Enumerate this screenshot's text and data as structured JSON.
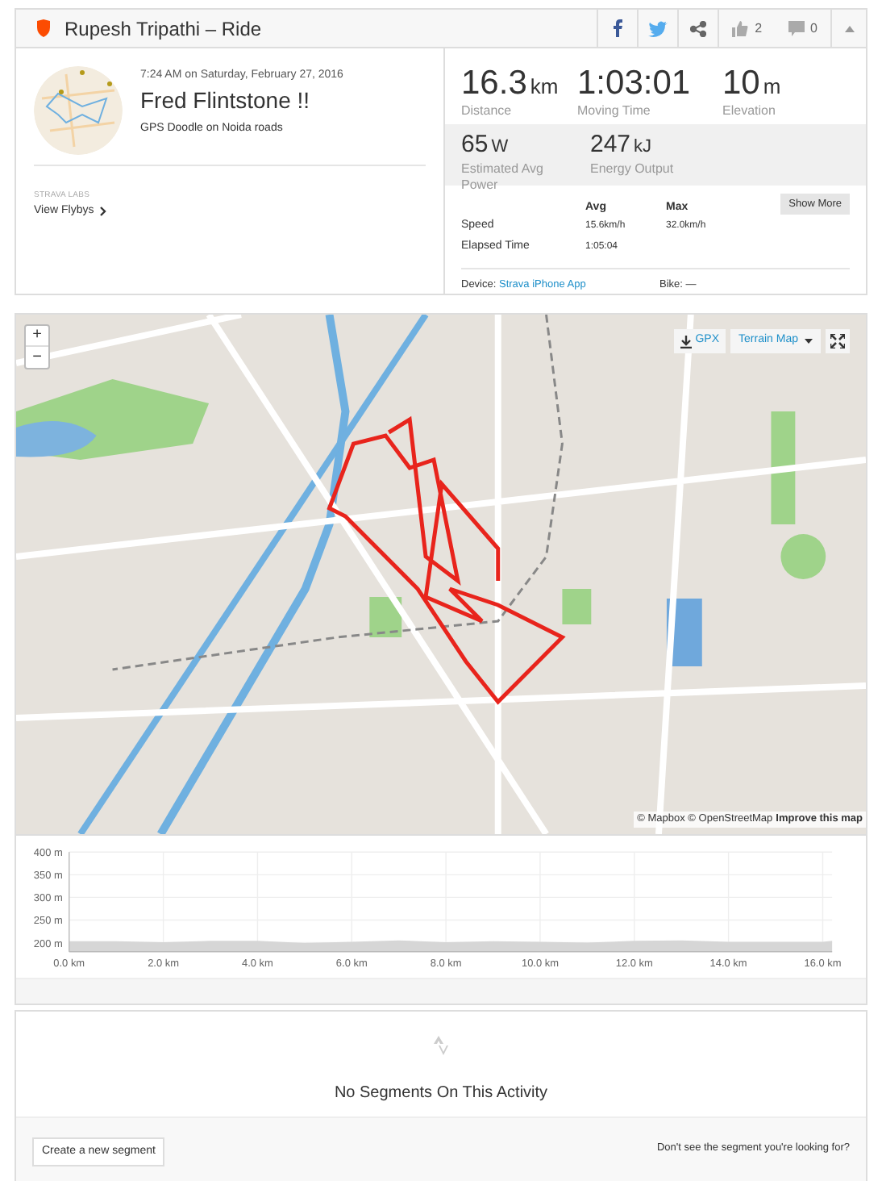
{
  "header": {
    "title": "Rupesh Tripathi – Ride",
    "kudos": "2",
    "comments": "0"
  },
  "activity": {
    "datetime": "7:24 AM on Saturday, February 27, 2016",
    "name": "Fred Flintstone !!",
    "description": "GPS Doodle on Noida roads",
    "labs_label": "STRAVA LABS",
    "flybys_link": "View Flybys"
  },
  "primary_stats": [
    {
      "value": "16.3",
      "unit": "km",
      "label": "Distance"
    },
    {
      "value": "1:03:01",
      "label": "Moving Time"
    },
    {
      "value": "10",
      "unit": "m",
      "label": "Elevation"
    }
  ],
  "secondary_stats": [
    {
      "value": "65",
      "unit": "W",
      "label": "Estimated Avg Power"
    },
    {
      "value": "247",
      "unit": "kJ",
      "label": "Energy Output"
    }
  ],
  "more_stats": {
    "columns": [
      "Avg",
      "Max"
    ],
    "show_more": "Show More",
    "rows": [
      {
        "label": "Speed",
        "avg": "15.6km/h",
        "max": "32.0km/h"
      },
      {
        "label": "Elapsed Time",
        "avg": "1:05:04"
      }
    ]
  },
  "device": {
    "label": "Device:",
    "value": "Strava iPhone App",
    "bike_label": "Bike:",
    "bike_value": "—"
  },
  "map": {
    "zoom_in": "+",
    "zoom_out": "−",
    "gpx": "GPX",
    "map_type": "Terrain Map",
    "attribution": "© Mapbox © OpenStreetMap",
    "improve_link": "Improve this map"
  },
  "elevation": {
    "chart_data": {
      "type": "area",
      "x": [
        0,
        1,
        2,
        3,
        4,
        5,
        6,
        7,
        8,
        9,
        10,
        11,
        12,
        13,
        14,
        15,
        16,
        16.2
      ],
      "grid": true,
      "series": [
        {
          "color": "#d6d6d6",
          "values": [
            203,
            203,
            201,
            204,
            204,
            199,
            202,
            205,
            201,
            203,
            202,
            200,
            204,
            205,
            202,
            202,
            202,
            204
          ]
        }
      ],
      "xlim": [
        0,
        16.2
      ],
      "ylim": [
        180,
        400
      ],
      "xticks": [
        {
          "value": 0,
          "label": "0.0 km"
        },
        {
          "value": 2,
          "label": "2.0 km"
        },
        {
          "value": 4,
          "label": "4.0 km"
        },
        {
          "value": 6,
          "label": "6.0 km"
        },
        {
          "value": 8,
          "label": "8.0 km"
        },
        {
          "value": 10,
          "label": "10.0 km"
        },
        {
          "value": 12,
          "label": "12.0 km"
        },
        {
          "value": 14,
          "label": "14.0 km"
        },
        {
          "value": 16,
          "label": "16.0 km"
        }
      ],
      "yticks": [
        {
          "value": 200,
          "label": "200 m"
        },
        {
          "value": 250,
          "label": "250 m"
        },
        {
          "value": 300,
          "label": "300 m"
        },
        {
          "value": 350,
          "label": "350 m"
        },
        {
          "value": 400,
          "label": "400 m"
        }
      ]
    }
  },
  "segments": {
    "empty_title": "No Segments On This Activity",
    "create_button": "Create a new segment",
    "help_text": "Don't see the segment you're looking for?"
  }
}
